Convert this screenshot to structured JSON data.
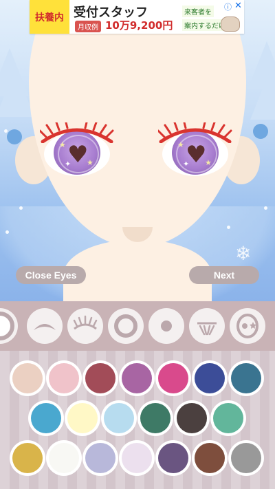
{
  "ad": {
    "badge": "扶養内",
    "title": "受付スタッフ",
    "pill": "月収例",
    "price": "10万9,200円",
    "line1": "来客者を",
    "line2": "案内するだけ",
    "info_icon": "info-icon",
    "close_icon": "close-icon"
  },
  "buttons": {
    "close_eyes": "Close Eyes",
    "next": "Next"
  },
  "categories": [
    "scroll-partial",
    "eyebrow",
    "eyelashes",
    "eye-outline",
    "pupil",
    "eye-highlight",
    "eye-sparkle"
  ],
  "palette": {
    "row1": [
      "#ebd0c2",
      "#f0c3ca",
      "#a24c58",
      "#a865a3",
      "#d94a8c",
      "#3c4d98",
      "#3a7490"
    ],
    "row2": [
      "#4aa8cf",
      "#fff8c6",
      "#b7dcef",
      "#3e7a66",
      "#4b403f",
      "#62b69b"
    ],
    "row3": [
      "#d9b44a",
      "#f8f8f4",
      "#b8b8da",
      "#ece0ee",
      "#6a5581",
      "#7e4e3d",
      "#999999"
    ]
  }
}
